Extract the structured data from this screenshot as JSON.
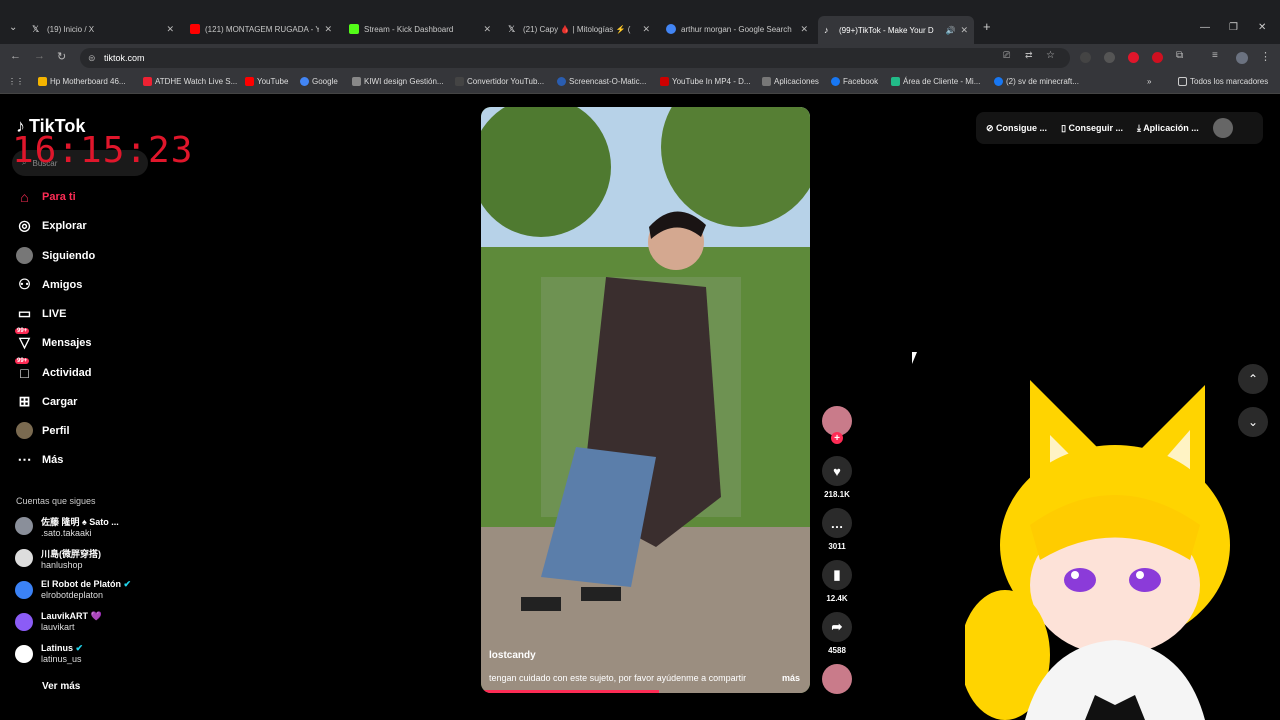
{
  "browser": {
    "tabs": [
      {
        "title": "(19) Inicio / X",
        "color": "#000000"
      },
      {
        "title": "(121) MONTAGEM RUGADA - Y",
        "color": "#ff0000"
      },
      {
        "title": "Stream - Kick Dashboard",
        "color": "#53fc18"
      },
      {
        "title": "(21) Capy 🩸 | Mitologías ⚡ (",
        "color": "#000000"
      },
      {
        "title": "arthur morgan - Google Search",
        "color": "#4285f4"
      },
      {
        "title": "(99+)TikTok - Make Your D",
        "color": "#000000"
      }
    ],
    "url": "tiktok.com",
    "bookmarks": [
      "Hp Motherboard 46...",
      "ATDHE Watch Live S...",
      "YouTube",
      "Google",
      "KIWI design Gestión...",
      "Convertidor YouTub...",
      "Screencast-O-Matic...",
      "YouTube In MP4 - D...",
      "Aplicaciones",
      "Facebook",
      "Área de Cliente - Mi...",
      "(2) sv de minecraft..."
    ],
    "all_bookmarks": "Todos los marcadores"
  },
  "overlay_clock": "16:15:23",
  "tiktok": {
    "logo": "TikTok",
    "search_placeholder": "Buscar",
    "nav": [
      {
        "label": "Para ti",
        "icon": "home-icon",
        "active": true
      },
      {
        "label": "Explorar",
        "icon": "compass-icon"
      },
      {
        "label": "Siguiendo",
        "icon": "following-icon"
      },
      {
        "label": "Amigos",
        "icon": "friends-icon"
      },
      {
        "label": "LIVE",
        "icon": "live-icon"
      },
      {
        "label": "Mensajes",
        "icon": "messages-icon",
        "badge": "99+"
      },
      {
        "label": "Actividad",
        "icon": "activity-icon",
        "badge": "99+"
      },
      {
        "label": "Cargar",
        "icon": "upload-icon"
      },
      {
        "label": "Perfil",
        "icon": "profile-icon"
      },
      {
        "label": "Más",
        "icon": "more-icon"
      }
    ],
    "following_title": "Cuentas que sigues",
    "following": [
      {
        "name": "佐藤 隆明 ♠ Sato ...",
        "handle": ".sato.takaaki"
      },
      {
        "name": "川島(微胖穿搭)",
        "handle": "hanlushop"
      },
      {
        "name": "El Robot de Platón",
        "handle": "elrobotdeplaton"
      },
      {
        "name": "LauvikART 💜",
        "handle": "lauvikart"
      },
      {
        "name": "Latinus",
        "handle": "latinus_us"
      }
    ],
    "see_more": "Ver más",
    "top_actions": [
      "Consigue ...",
      "Conseguir ...",
      "Aplicación ..."
    ],
    "video": {
      "author": "lostcandy",
      "caption": "tengan cuidado  con este sujeto, por favor ayúdenme a compartir",
      "more": "más",
      "progress": 0.54
    },
    "actions": [
      {
        "icon": "heart-icon",
        "count": "218.1K"
      },
      {
        "icon": "comment-icon",
        "count": "3011"
      },
      {
        "icon": "bookmark-icon",
        "count": "12.4K"
      },
      {
        "icon": "share-icon",
        "count": "4588"
      }
    ]
  }
}
